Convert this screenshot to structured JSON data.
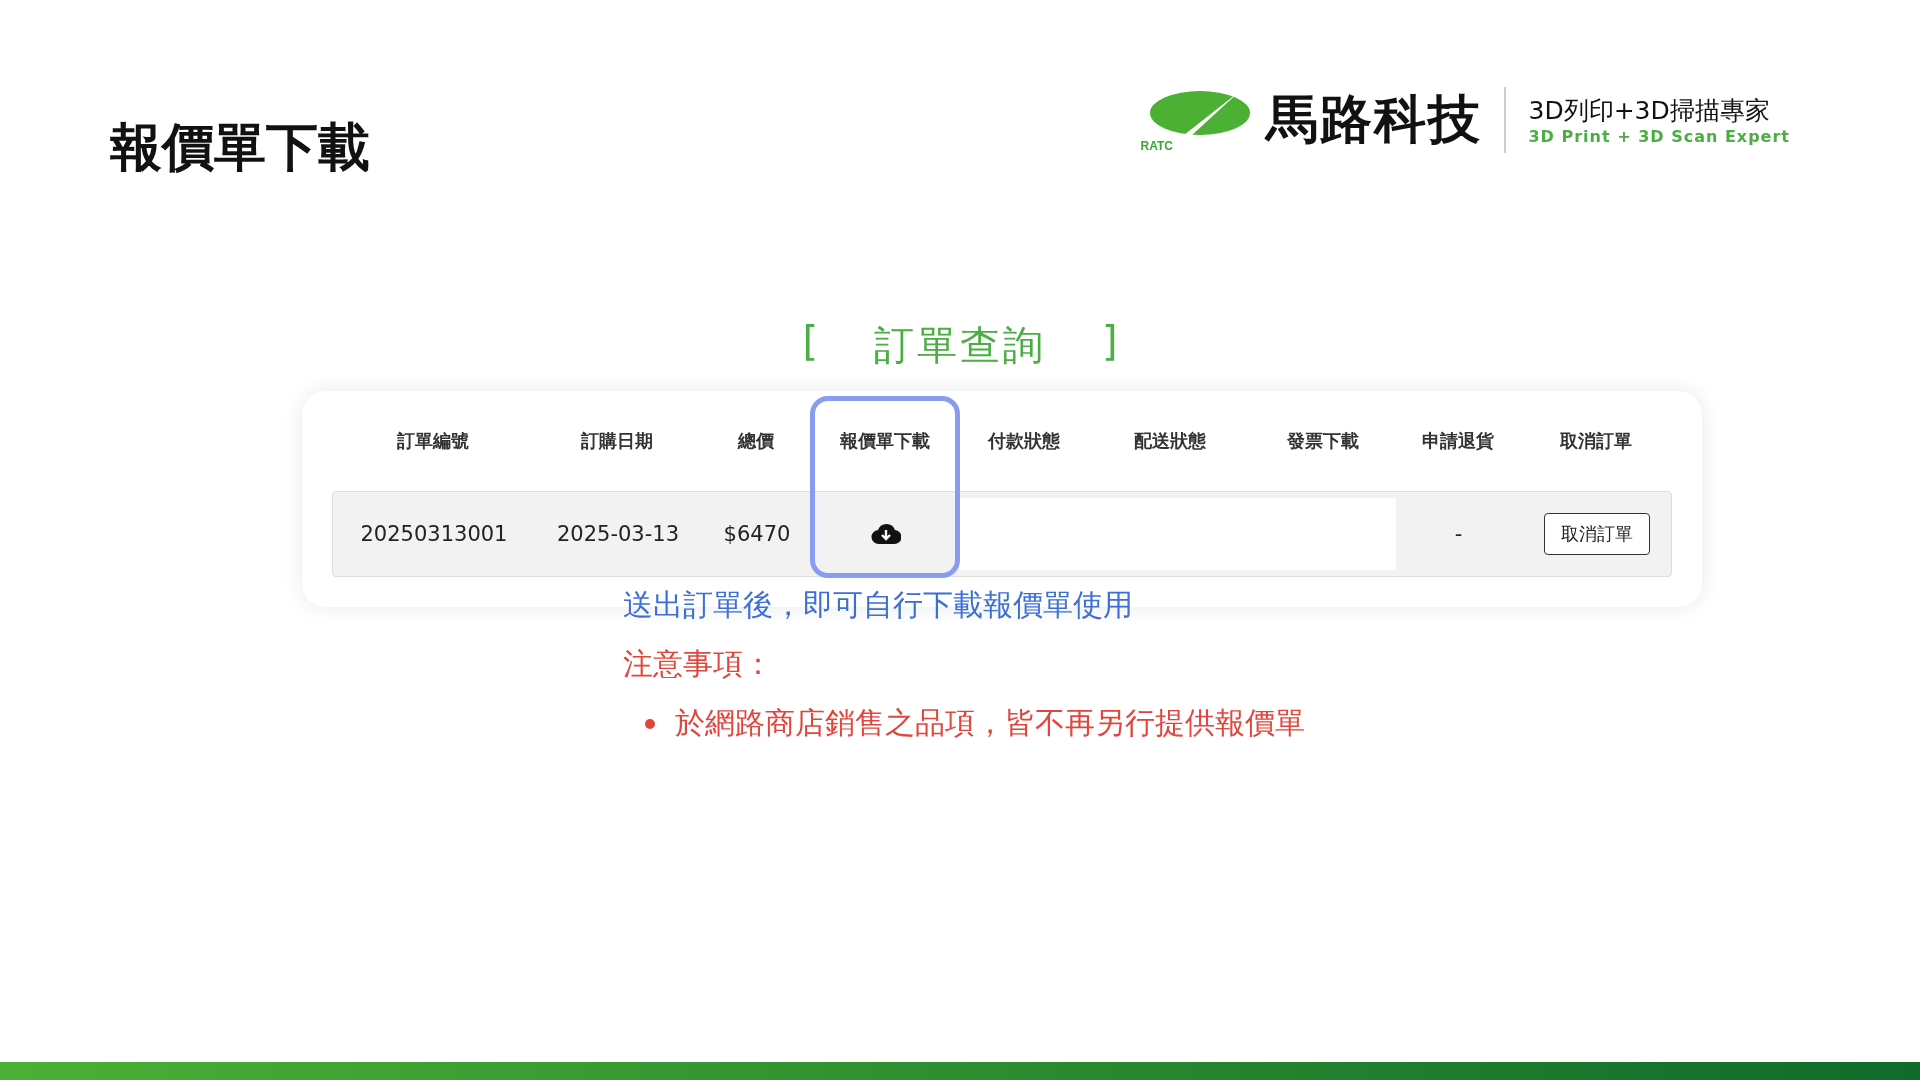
{
  "slide": {
    "title": "報價單下載"
  },
  "logo": {
    "mark": "RATC",
    "name": "馬路科技",
    "tagline": "3D列印+3D掃描專家",
    "tagline_en": "3D Print + 3D Scan Expert"
  },
  "section_title": {
    "open": "[",
    "text": "訂單查詢",
    "close": "]"
  },
  "table": {
    "columns": [
      {
        "label": "訂單編號",
        "highlighted": false
      },
      {
        "label": "訂購日期",
        "highlighted": false
      },
      {
        "label": "總價",
        "highlighted": false
      },
      {
        "label": "報價單下載",
        "highlighted": true
      },
      {
        "label": "付款狀態",
        "highlighted": false
      },
      {
        "label": "配送狀態",
        "highlighted": false
      },
      {
        "label": "發票下載",
        "highlighted": false
      },
      {
        "label": "申請退貨",
        "highlighted": false
      },
      {
        "label": "取消訂單",
        "highlighted": false
      }
    ],
    "rows": [
      {
        "cells": [
          {
            "kind": "text",
            "text": "20250313001"
          },
          {
            "kind": "text",
            "text": "2025-03-13"
          },
          {
            "kind": "text",
            "text": "$6470"
          },
          {
            "kind": "download"
          },
          {
            "kind": "blank"
          },
          {
            "kind": "blank"
          },
          {
            "kind": "blank"
          },
          {
            "kind": "text",
            "text": "-"
          },
          {
            "kind": "button",
            "text": "取消訂單"
          }
        ]
      }
    ]
  },
  "note": "送出訂單後，即可自行下載報價單使用",
  "caution": {
    "heading": "注意事項：",
    "items": [
      "於網路商店銷售之品項，皆不再另行提供報價單"
    ]
  }
}
